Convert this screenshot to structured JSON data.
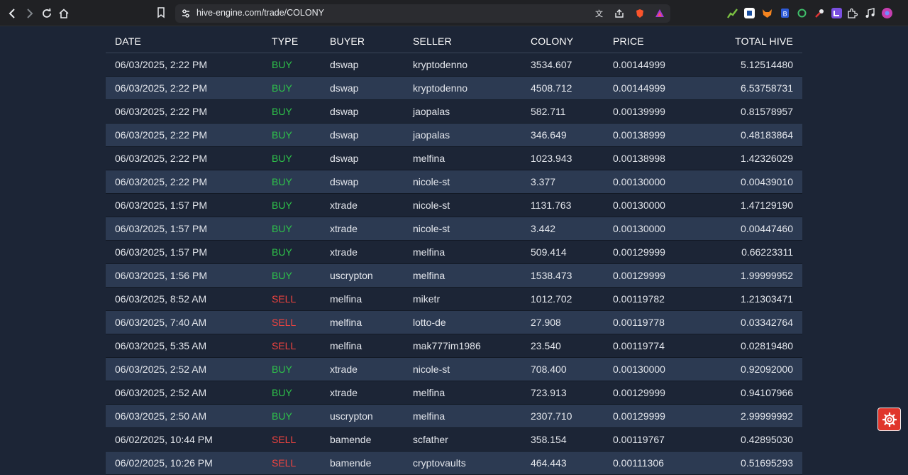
{
  "browser": {
    "url": "hive-engine.com/trade/COLONY"
  },
  "table": {
    "headers": {
      "date": "DATE",
      "type": "TYPE",
      "buyer": "BUYER",
      "seller": "SELLER",
      "colony": "COLONY",
      "price": "PRICE",
      "total": "TOTAL HIVE"
    },
    "rows": [
      {
        "date": "06/03/2025, 2:22 PM",
        "type": "BUY",
        "buyer": "dswap",
        "seller": "kryptodenno",
        "colony": "3534.607",
        "price": "0.00144999",
        "total": "5.12514480"
      },
      {
        "date": "06/03/2025, 2:22 PM",
        "type": "BUY",
        "buyer": "dswap",
        "seller": "kryptodenno",
        "colony": "4508.712",
        "price": "0.00144999",
        "total": "6.53758731"
      },
      {
        "date": "06/03/2025, 2:22 PM",
        "type": "BUY",
        "buyer": "dswap",
        "seller": "jaopalas",
        "colony": "582.711",
        "price": "0.00139999",
        "total": "0.81578957"
      },
      {
        "date": "06/03/2025, 2:22 PM",
        "type": "BUY",
        "buyer": "dswap",
        "seller": "jaopalas",
        "colony": "346.649",
        "price": "0.00138999",
        "total": "0.48183864"
      },
      {
        "date": "06/03/2025, 2:22 PM",
        "type": "BUY",
        "buyer": "dswap",
        "seller": "melfina",
        "colony": "1023.943",
        "price": "0.00138998",
        "total": "1.42326029"
      },
      {
        "date": "06/03/2025, 2:22 PM",
        "type": "BUY",
        "buyer": "dswap",
        "seller": "nicole-st",
        "colony": "3.377",
        "price": "0.00130000",
        "total": "0.00439010"
      },
      {
        "date": "06/03/2025, 1:57 PM",
        "type": "BUY",
        "buyer": "xtrade",
        "seller": "nicole-st",
        "colony": "1131.763",
        "price": "0.00130000",
        "total": "1.47129190"
      },
      {
        "date": "06/03/2025, 1:57 PM",
        "type": "BUY",
        "buyer": "xtrade",
        "seller": "nicole-st",
        "colony": "3.442",
        "price": "0.00130000",
        "total": "0.00447460"
      },
      {
        "date": "06/03/2025, 1:57 PM",
        "type": "BUY",
        "buyer": "xtrade",
        "seller": "melfina",
        "colony": "509.414",
        "price": "0.00129999",
        "total": "0.66223311"
      },
      {
        "date": "06/03/2025, 1:56 PM",
        "type": "BUY",
        "buyer": "uscrypton",
        "seller": "melfina",
        "colony": "1538.473",
        "price": "0.00129999",
        "total": "1.99999952"
      },
      {
        "date": "06/03/2025, 8:52 AM",
        "type": "SELL",
        "buyer": "melfina",
        "seller": "miketr",
        "colony": "1012.702",
        "price": "0.00119782",
        "total": "1.21303471"
      },
      {
        "date": "06/03/2025, 7:40 AM",
        "type": "SELL",
        "buyer": "melfina",
        "seller": "lotto-de",
        "colony": "27.908",
        "price": "0.00119778",
        "total": "0.03342764"
      },
      {
        "date": "06/03/2025, 5:35 AM",
        "type": "SELL",
        "buyer": "melfina",
        "seller": "mak777im1986",
        "colony": "23.540",
        "price": "0.00119774",
        "total": "0.02819480"
      },
      {
        "date": "06/03/2025, 2:52 AM",
        "type": "BUY",
        "buyer": "xtrade",
        "seller": "nicole-st",
        "colony": "708.400",
        "price": "0.00130000",
        "total": "0.92092000"
      },
      {
        "date": "06/03/2025, 2:52 AM",
        "type": "BUY",
        "buyer": "xtrade",
        "seller": "melfina",
        "colony": "723.913",
        "price": "0.00129999",
        "total": "0.94107966"
      },
      {
        "date": "06/03/2025, 2:50 AM",
        "type": "BUY",
        "buyer": "uscrypton",
        "seller": "melfina",
        "colony": "2307.710",
        "price": "0.00129999",
        "total": "2.99999992"
      },
      {
        "date": "06/02/2025, 10:44 PM",
        "type": "SELL",
        "buyer": "bamende",
        "seller": "scfather",
        "colony": "358.154",
        "price": "0.00119767",
        "total": "0.42895030"
      },
      {
        "date": "06/02/2025, 10:26 PM",
        "type": "SELL",
        "buyer": "bamende",
        "seller": "cryptovaults",
        "colony": "464.443",
        "price": "0.00111306",
        "total": "0.51695293"
      }
    ]
  },
  "colors": {
    "buy": "#2ec24a",
    "sell": "#f0433f",
    "page_bg": "#1c2536",
    "row_alt": "#2c3a52"
  }
}
